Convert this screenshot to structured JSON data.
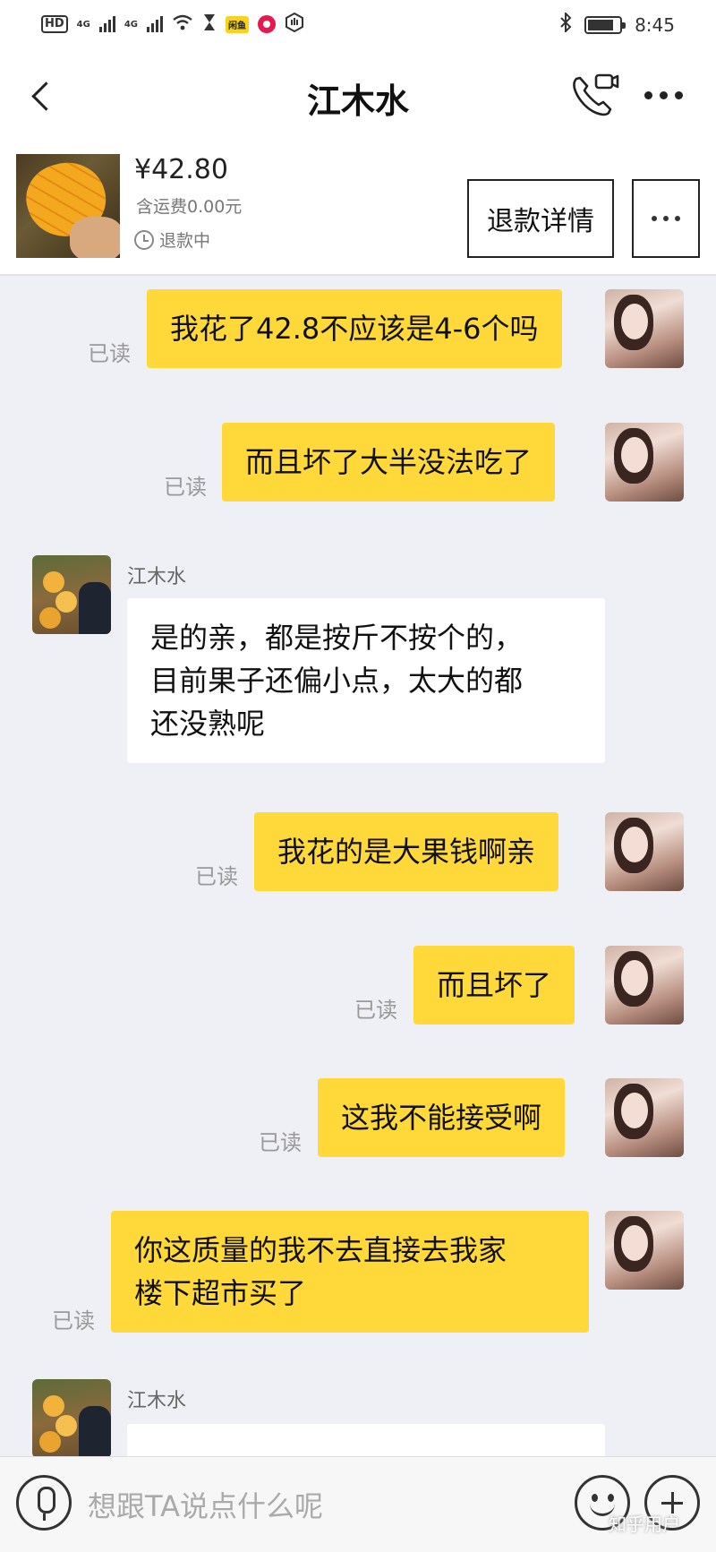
{
  "status_bar": {
    "hd": "HD",
    "signal1": "4G",
    "signal2": "4G",
    "app_badge": "闲鱼",
    "time": "8:45"
  },
  "header": {
    "title": "江木水"
  },
  "product": {
    "price": "¥42.80",
    "shipping": "含运费0.00元",
    "status": "退款中",
    "refund_button": "退款详情"
  },
  "messages": [
    {
      "from": "me",
      "text": "我花了42.8不应该是4-6个吗",
      "read": "已读"
    },
    {
      "from": "me",
      "text": "而且坏了大半没法吃了",
      "read": "已读"
    },
    {
      "from": "them",
      "sender": "江木水",
      "lines": [
        "是的亲，都是按斤不按个的，",
        "目前果子还偏小点，太大的都",
        "还没熟呢"
      ]
    },
    {
      "from": "me",
      "text": "我花的是大果钱啊亲",
      "read": "已读"
    },
    {
      "from": "me",
      "text": "而且坏了",
      "read": "已读"
    },
    {
      "from": "me",
      "text": "这我不能接受啊",
      "read": "已读"
    },
    {
      "from": "me",
      "lines": [
        "你这质量的我不去直接去我家",
        "楼下超市买了"
      ],
      "read": "已读"
    },
    {
      "from": "them",
      "sender": "江木水"
    }
  ],
  "input": {
    "placeholder": "想跟TA说点什么呢"
  },
  "watermark": "知乎用户"
}
